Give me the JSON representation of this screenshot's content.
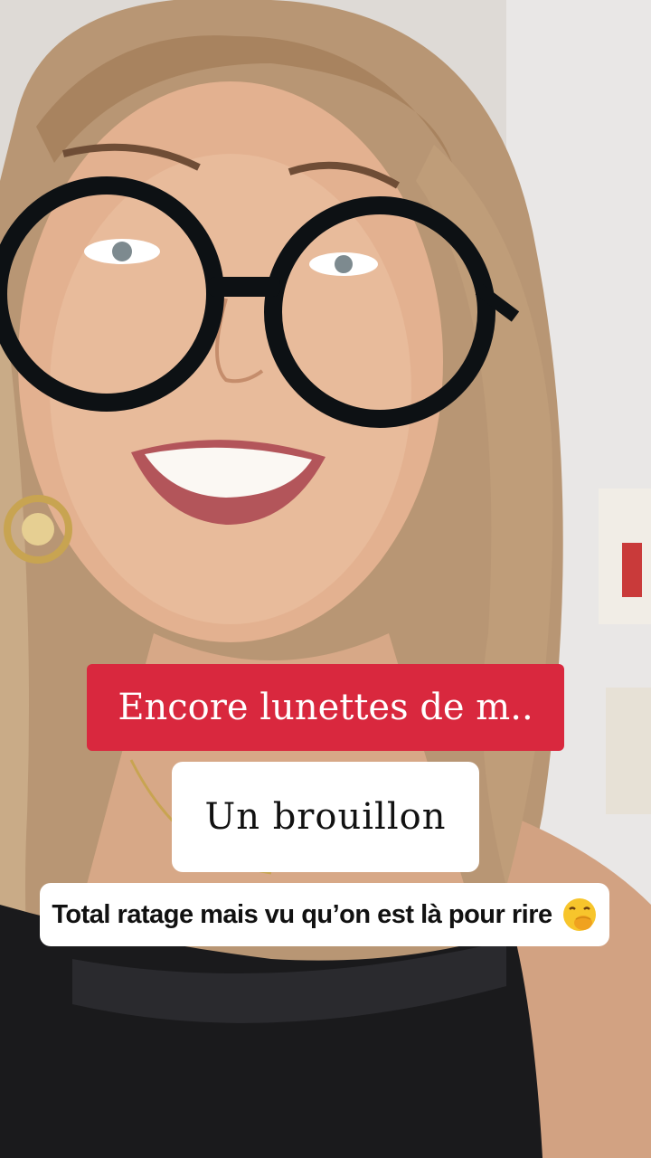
{
  "captions": {
    "title": "Encore lunettes de m..",
    "subtitle": "Un brouillon",
    "comment": "Total ratage mais vu qu’on est là pour rire"
  },
  "icons": {
    "comment_emoji": "face-with-hand-over-mouth-emoji",
    "photo": "woman-with-round-glasses-selfie"
  },
  "colors": {
    "title_background": "#d9283e",
    "caption_background": "#ffffff",
    "caption_text": "#111111"
  }
}
